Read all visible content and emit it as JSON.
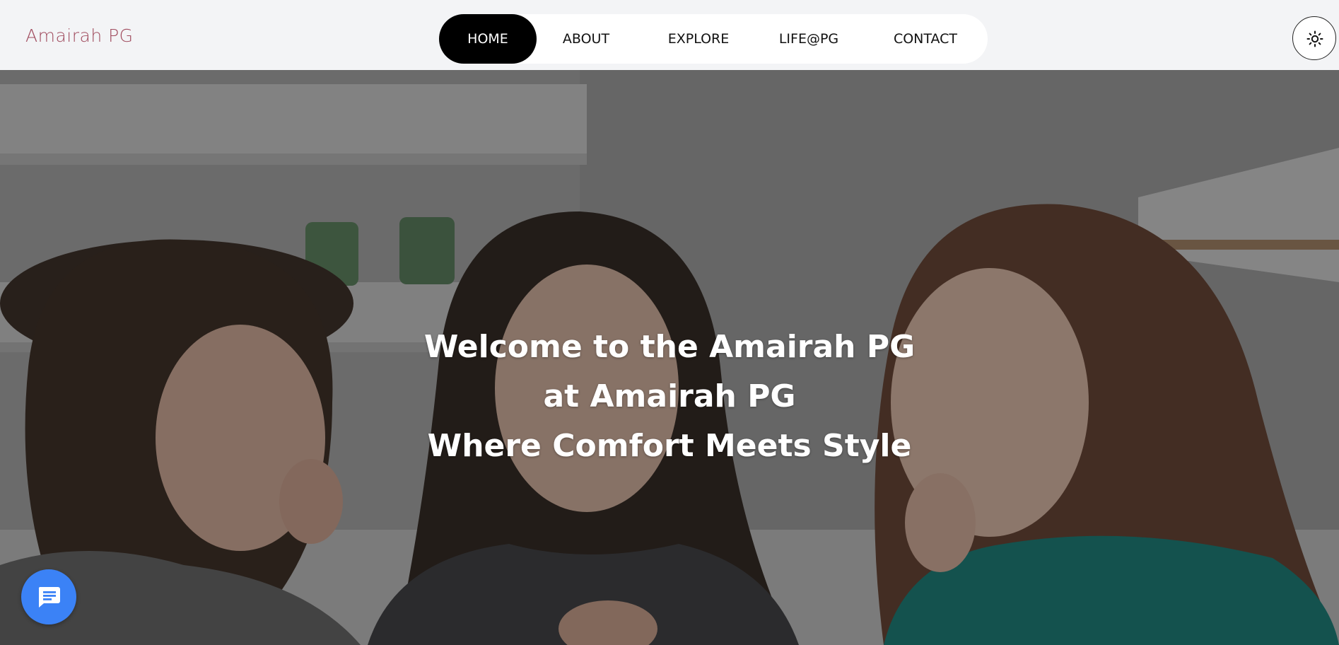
{
  "brand": {
    "name": "Amairah PG",
    "color": "#a04b5e"
  },
  "nav": {
    "items": [
      {
        "label": "HOME",
        "active": true
      },
      {
        "label": "ABOUT",
        "active": false
      },
      {
        "label": "EXPLORE",
        "active": false
      },
      {
        "label": "LIFE@PG",
        "active": false
      },
      {
        "label": "CONTACT",
        "active": false
      }
    ]
  },
  "theme_toggle": {
    "icon": "sun-icon"
  },
  "hero": {
    "lines": [
      "Welcome to the Amairah PG",
      "at Amairah PG",
      "Where Comfort Meets Style"
    ],
    "image_subject": "three women in kitchen"
  },
  "chat": {
    "icon": "chat-bubble-icon",
    "color": "#3b82f6"
  },
  "colors": {
    "active_nav_bg": "#000000",
    "header_bg": "#f3f4f6"
  }
}
